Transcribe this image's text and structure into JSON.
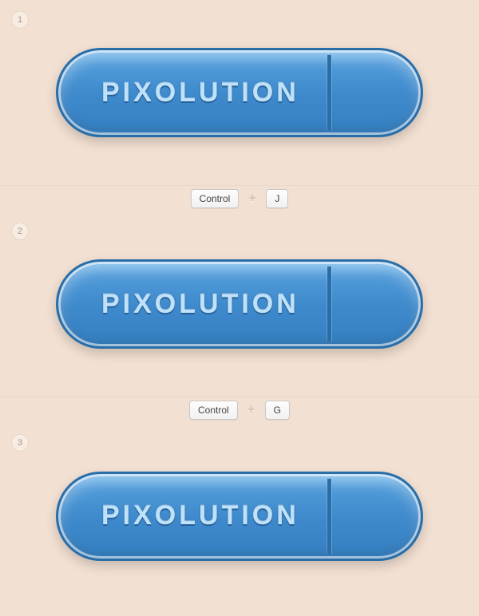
{
  "steps": [
    {
      "number": "1",
      "button_label": "PIXOLUTION"
    },
    {
      "number": "2",
      "button_label": "PIXOLUTION"
    },
    {
      "number": "3",
      "button_label": "PIXOLUTION"
    }
  ],
  "shortcuts": [
    {
      "key1": "Control",
      "key2": "J"
    },
    {
      "key1": "Control",
      "key2": "G"
    }
  ]
}
